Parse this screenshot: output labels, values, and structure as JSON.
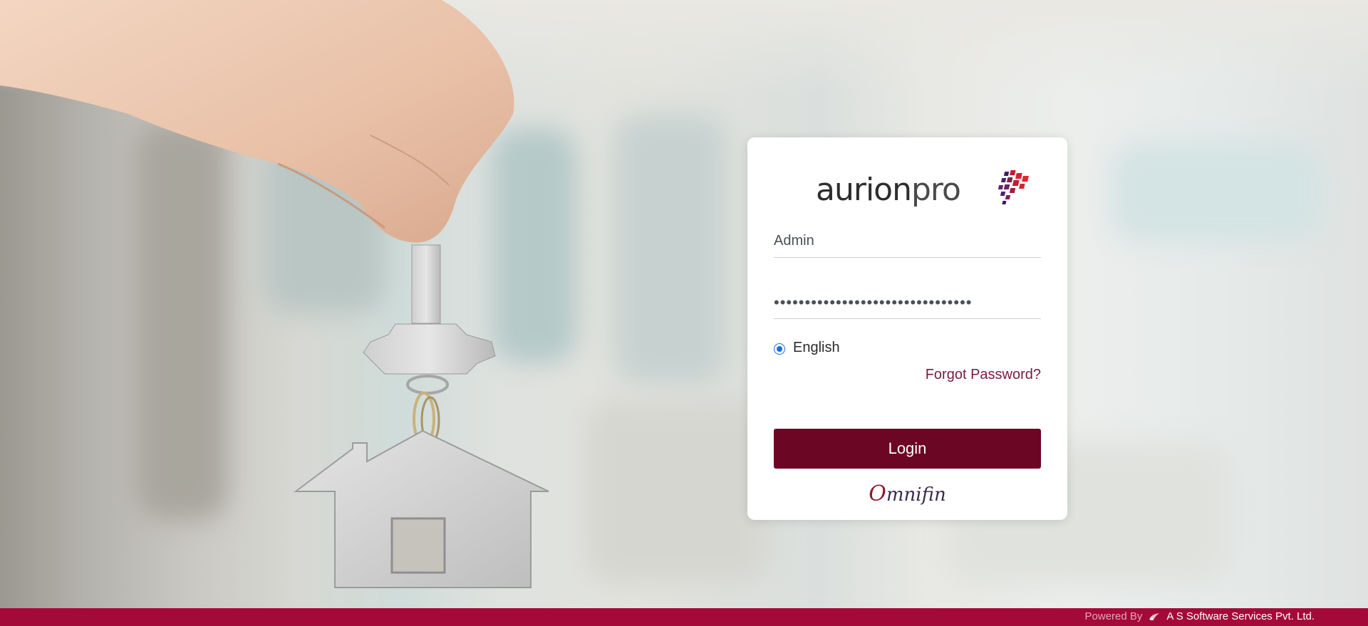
{
  "login": {
    "username_value": "Admin",
    "password_value": "••••••••••••••••••••••••••••••••",
    "language_label": "English",
    "forgot_label": "Forgot Password?",
    "login_label": "Login"
  },
  "branding": {
    "logo_name": "aurion",
    "logo_suffix": "pro",
    "product_initial": "O",
    "product_rest": "mnifin"
  },
  "footer": {
    "powered_label": "Powered By",
    "company_label": "A S Software Services Pvt. Ltd."
  },
  "colors": {
    "primary": "#6b0624",
    "footer_bg": "#a30a3a",
    "link": "#7a1a3f",
    "radio": "#1a6fd8"
  },
  "icons": [
    "aurionpro-logo-mark",
    "house-key-illustration",
    "company-logo-icon"
  ]
}
